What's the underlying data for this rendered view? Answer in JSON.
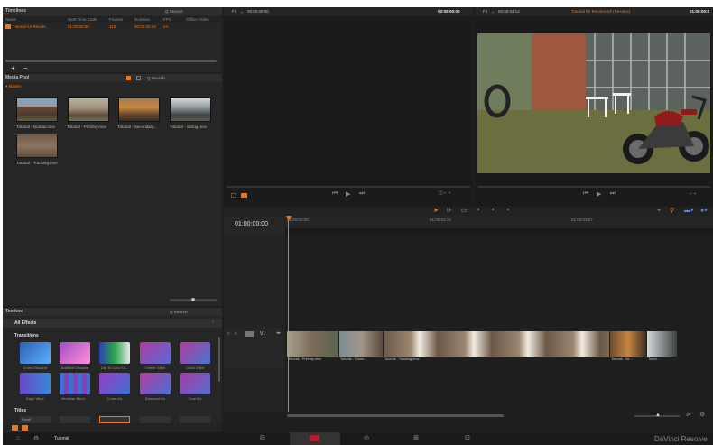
{
  "timelines": {
    "title": "Timelines",
    "search": "Q Search",
    "columns": [
      "Name",
      "Start Time Code",
      "Frames",
      "Duration",
      "FPS",
      "Offline Video"
    ],
    "row": {
      "name": "Tutorial for Resolv...",
      "start": "01:00:00:00",
      "frames": "110",
      "duration": "00:00:04:14",
      "fps": "24"
    },
    "add": "+",
    "remove": "−"
  },
  "media_pool": {
    "title": "Media Pool",
    "search": "Q Search",
    "bin": "▾ Master",
    "clips": [
      "Tutorial - Dumas.mov",
      "Tutorial - Primary.mov",
      "Tutorial - Secondary...",
      "Tutorial - Sizing.mov",
      "Tutorial - Tracking.mov"
    ]
  },
  "toolbox": {
    "title": "Toolbox",
    "search": "Q Search",
    "filter": "All Effects",
    "transitions_label": "Transitions",
    "transitions": [
      "Cross Dissolve",
      "Additive Dissolve",
      "Dip To Color Di...",
      "Center Wipe",
      "Clock Wipe",
      "Edge Wipe",
      "Venetian Blind ...",
      "Cross Iris",
      "Diamond Iris",
      "Oval Iris"
    ],
    "titles_label": "Titles",
    "title_item": "Scroll"
  },
  "source_viewer": {
    "mode": "Fit",
    "timecode_left": "00:00:00:00",
    "timecode_right": "00:00:00:00"
  },
  "timeline_viewer": {
    "mode": "Fit",
    "duration": "00:00:04:14",
    "timeline_name": "Tutorial for Resolve v8 (Resolve)",
    "timecode": "01:00:00:0"
  },
  "timeline": {
    "current_timecode": "01:00:00:00",
    "ruler": [
      "01:00:00:00",
      "01:00:01:12",
      "01:00:03:07"
    ],
    "track_name": "V1",
    "clip_labels": [
      "Tutorial - Primary.mov",
      "Tutorial - Come...",
      "Tutorial - Tracking.mov",
      "Tutorial - Se...",
      "Tutori..."
    ]
  },
  "bottom_bar": {
    "project": "Tutorial",
    "brand": "DaVinci Resolve"
  },
  "colors": {
    "accent": "#e8781e",
    "clip_stripe": "#445566",
    "selected": "#e8781e"
  }
}
